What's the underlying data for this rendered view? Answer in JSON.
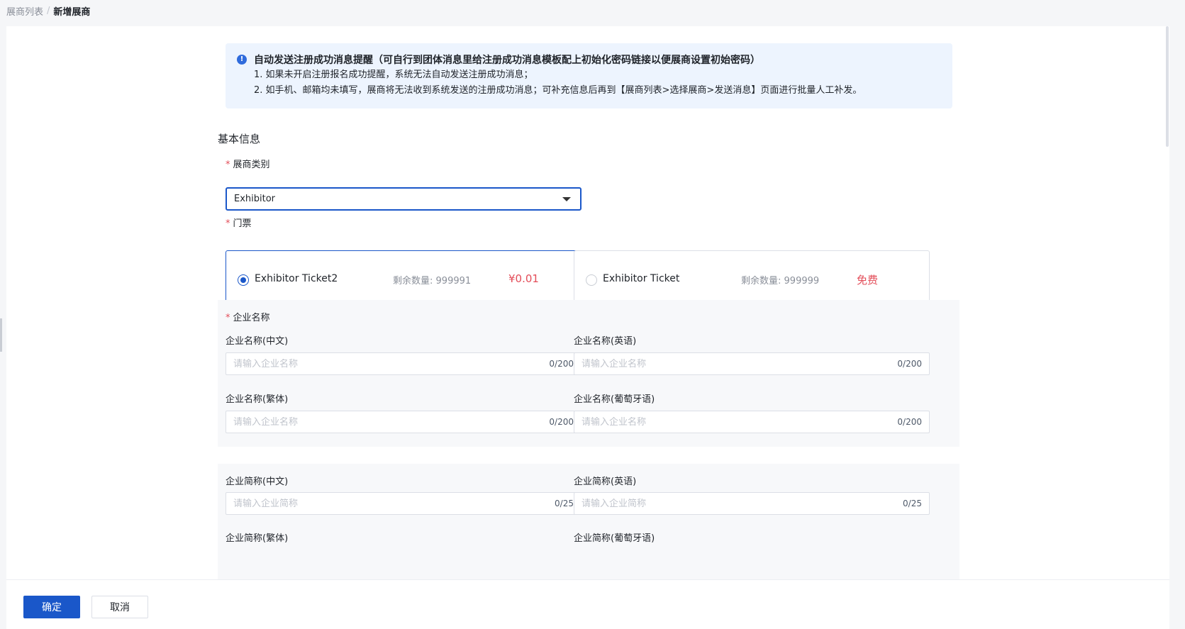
{
  "breadcrumb": {
    "parent": "展商列表",
    "separator": "/",
    "current": "新增展商"
  },
  "notice": {
    "icon": "info-icon",
    "title": "自动发送注册成功消息提醒（可自行到团体消息里给注册成功消息模板配上初始化密码链接以便展商设置初始密码）",
    "lines": [
      "1. 如果未开启注册报名成功提醒，系统无法自动发送注册成功消息；",
      "2. 如手机、邮箱均未填写，展商将无法收到系统发送的注册成功消息；可补充信息后再到【展商列表>选择展商>发送消息】页面进行批量人工补发。"
    ]
  },
  "section": {
    "title": "基本信息"
  },
  "required_mark": "*",
  "exhibitor_type": {
    "label": "展商类别",
    "value": "Exhibitor"
  },
  "ticket": {
    "label": "门票",
    "remain_label": "剩余数量:",
    "options": [
      {
        "name": "Exhibitor Ticket2",
        "remain": "999991",
        "price": "¥0.01",
        "selected": true
      },
      {
        "name": "Exhibitor Ticket",
        "remain": "999999",
        "price": "免费",
        "selected": false
      }
    ]
  },
  "company_name": {
    "label": "企业名称",
    "fields": [
      {
        "label": "企业名称(中文)",
        "placeholder": "请输入企业名称",
        "counter": "0/200"
      },
      {
        "label": "企业名称(英语)",
        "placeholder": "请输入企业名称",
        "counter": "0/200"
      },
      {
        "label": "企业名称(繁体)",
        "placeholder": "请输入企业名称",
        "counter": "0/200"
      },
      {
        "label": "企业名称(葡萄牙语)",
        "placeholder": "请输入企业名称",
        "counter": "0/200"
      }
    ]
  },
  "company_short": {
    "fields": [
      {
        "label": "企业简称(中文)",
        "placeholder": "请输入企业简称",
        "counter": "0/25"
      },
      {
        "label": "企业简称(英语)",
        "placeholder": "请输入企业简称",
        "counter": "0/25"
      },
      {
        "label": "企业简称(繁体)"
      },
      {
        "label": "企业简称(葡萄牙语)"
      }
    ]
  },
  "footer": {
    "confirm": "确定",
    "cancel": "取消"
  },
  "colors": {
    "primary": "#1a57c9",
    "danger": "#e34d59",
    "notice_bg": "#edf4fe"
  }
}
